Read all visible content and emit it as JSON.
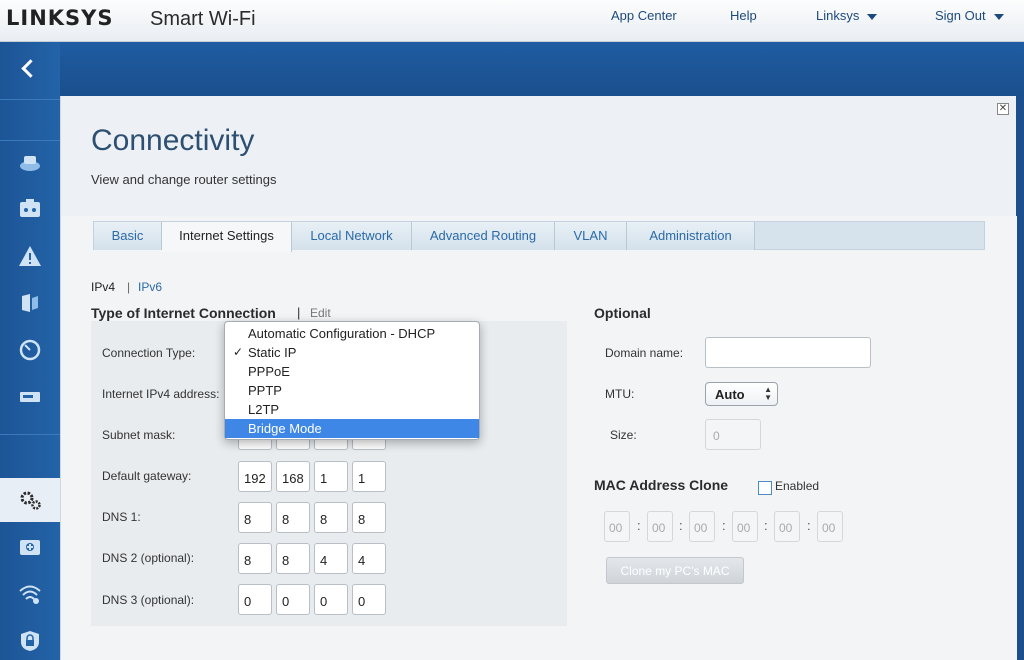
{
  "header": {
    "logo": "LINKSYS",
    "product": "Smart Wi-Fi",
    "nav": {
      "app_center": "App Center",
      "help": "Help",
      "user": "Linksys",
      "sign_out": "Sign Out"
    }
  },
  "sidebar": {
    "icons": [
      "router-icon",
      "devices-icon",
      "warning-icon",
      "parental-icon",
      "speedometer-icon",
      "storage-icon",
      "gear-icon",
      "media-icon",
      "wifi-icon",
      "security-lock-icon"
    ]
  },
  "page": {
    "title": "Connectivity",
    "subtitle": "View and change router settings",
    "close": "✕"
  },
  "tabs": [
    {
      "label": "Basic"
    },
    {
      "label": "Internet Settings"
    },
    {
      "label": "Local Network"
    },
    {
      "label": "Advanced Routing"
    },
    {
      "label": "VLAN"
    },
    {
      "label": "Administration"
    }
  ],
  "ip_tabs": {
    "ipv4": "IPv4",
    "separator": "|",
    "ipv6": "IPv6"
  },
  "connection": {
    "title": "Type of Internet Connection",
    "separator": "|",
    "edit": "Edit",
    "labels": {
      "type": "Connection Type:",
      "ipv4": "Internet IPv4 address:",
      "subnet": "Subnet mask:",
      "gateway": "Default gateway:",
      "dns1": "DNS 1:",
      "dns2": "DNS 2 (optional):",
      "dns3": "DNS 3 (optional):"
    },
    "gateway": [
      "192",
      "168",
      "1",
      "1"
    ],
    "dns1": [
      "8",
      "8",
      "8",
      "8"
    ],
    "dns2": [
      "8",
      "8",
      "4",
      "4"
    ],
    "dns3": [
      "0",
      "0",
      "0",
      "0"
    ]
  },
  "dropdown": {
    "checkmark": "✓",
    "options": [
      "Automatic Configuration - DHCP",
      "Static IP",
      "PPPoE",
      "PPTP",
      "L2TP",
      "Bridge Mode"
    ],
    "checked": "Static IP",
    "highlighted": "Bridge Mode"
  },
  "optional": {
    "title": "Optional",
    "domain_label": "Domain name:",
    "domain_value": "",
    "mtu_label": "MTU:",
    "mtu_value": "Auto",
    "size_label": "Size:",
    "size_value": "0"
  },
  "mac_clone": {
    "title": "MAC Address Clone",
    "enabled_label": "Enabled",
    "octets": [
      "00",
      "00",
      "00",
      "00",
      "00",
      "00"
    ],
    "colon": ":",
    "button": "Clone my PC's MAC"
  },
  "colors": {
    "brand_blue": "#1d5596",
    "link": "#2a6aa8",
    "highlight": "#3f87e6"
  }
}
